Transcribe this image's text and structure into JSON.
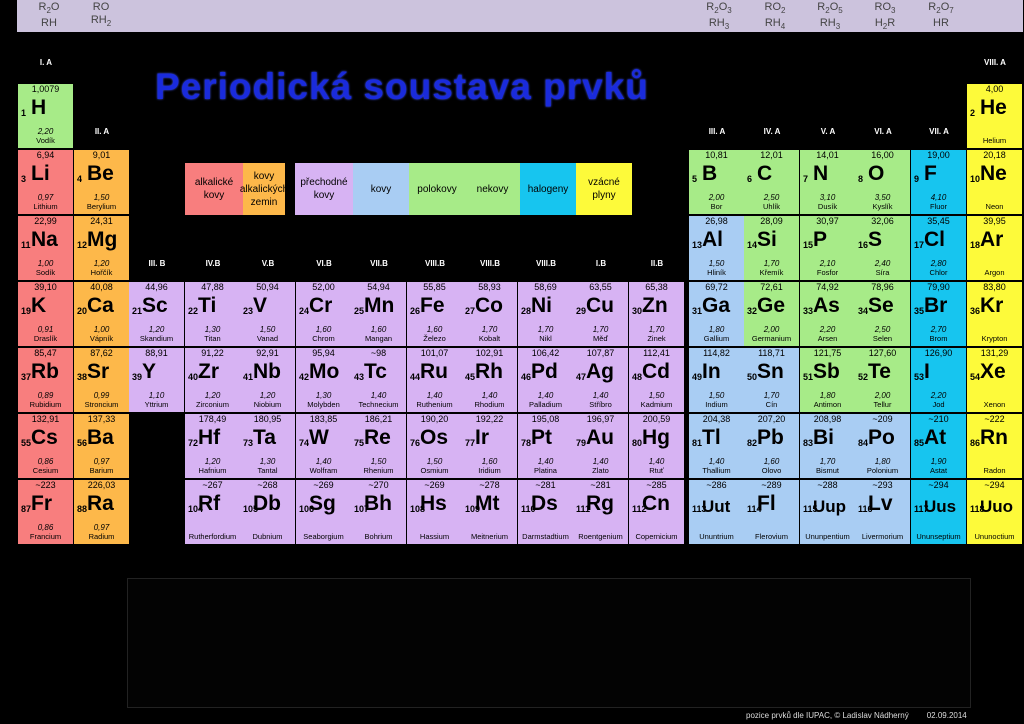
{
  "title": "Periodická soustava prvků",
  "oxides": [
    {
      "l1": "R|2|O",
      "l2": "RH|"
    },
    {
      "l1": "RO|",
      "l2": "RH|2"
    },
    {
      "l1": "R|2|O|3",
      "l2": "RH|3"
    },
    {
      "l1": "RO|2",
      "l2": "RH|4"
    },
    {
      "l1": "R|2|O|5",
      "l2": "RH|3"
    },
    {
      "l1": "RO|3",
      "l2": "H|2|R"
    },
    {
      "l1": "R|2|O|7",
      "l2": "HR|"
    }
  ],
  "groups": [
    "I. A",
    "VIII. A",
    "II. A",
    "III. A",
    "IV. A",
    "V. A",
    "VI. A",
    "VII. A",
    "III. B",
    "IV.B",
    "V.B",
    "VI.B",
    "VII.B",
    "VIII.B",
    "VIII.B",
    "VIII.B",
    "I.B",
    "II.B"
  ],
  "legend": [
    "alkalické kovy",
    "kovy alkalických zemin",
    "přechodné kovy",
    "kovy",
    "polokovy",
    "nekovy",
    "halogeny",
    "vzácné plyny"
  ],
  "colors": {
    "alk": "#f87e7e",
    "zem": "#fdb84a",
    "pre": "#d7b3f3",
    "kov": "#a9cdf3",
    "pol": "#a7eb88",
    "nek": "#a7eb88",
    "hal": "#17c5ef",
    "vzac": "#fdfa3a",
    "title": "#1a2bdc"
  },
  "elements": [
    {
      "m": "1,0079",
      "z": "1",
      "s": "H",
      "e": "2,20",
      "n": "Vodík",
      "c": "nek",
      "col": 1,
      "row": 1
    },
    {
      "m": "4,00",
      "z": "2",
      "s": "He",
      "e": "",
      "n": "Helium",
      "c": "vzac",
      "col": 18,
      "row": 1
    },
    {
      "m": "6,94",
      "z": "3",
      "s": "Li",
      "e": "0,97",
      "n": "Lithium",
      "c": "alk",
      "col": 1,
      "row": 2
    },
    {
      "m": "9,01",
      "z": "4",
      "s": "Be",
      "e": "1,50",
      "n": "Berylium",
      "c": "zem",
      "col": 2,
      "row": 2
    },
    {
      "m": "10,81",
      "z": "5",
      "s": "B",
      "e": "2,00",
      "n": "Bor",
      "c": "pol",
      "col": 13,
      "row": 2
    },
    {
      "m": "12,01",
      "z": "6",
      "s": "C",
      "e": "2,50",
      "n": "Uhlík",
      "c": "nek",
      "col": 14,
      "row": 2
    },
    {
      "m": "14,01",
      "z": "7",
      "s": "N",
      "e": "3,10",
      "n": "Dusík",
      "c": "nek",
      "col": 15,
      "row": 2
    },
    {
      "m": "16,00",
      "z": "8",
      "s": "O",
      "e": "3,50",
      "n": "Kyslík",
      "c": "nek",
      "col": 16,
      "row": 2
    },
    {
      "m": "19,00",
      "z": "9",
      "s": "F",
      "e": "4,10",
      "n": "Fluor",
      "c": "hal",
      "col": 17,
      "row": 2
    },
    {
      "m": "20,18",
      "z": "10",
      "s": "Ne",
      "e": "",
      "n": "Neon",
      "c": "vzac",
      "col": 18,
      "row": 2
    },
    {
      "m": "22,99",
      "z": "11",
      "s": "Na",
      "e": "1,00",
      "n": "Sodík",
      "c": "alk",
      "col": 1,
      "row": 3
    },
    {
      "m": "24,31",
      "z": "12",
      "s": "Mg",
      "e": "1,20",
      "n": "Hořčík",
      "c": "zem",
      "col": 2,
      "row": 3
    },
    {
      "m": "26,98",
      "z": "13",
      "s": "Al",
      "e": "1,50",
      "n": "Hliník",
      "c": "kov",
      "col": 13,
      "row": 3
    },
    {
      "m": "28,09",
      "z": "14",
      "s": "Si",
      "e": "1,70",
      "n": "Křemík",
      "c": "pol",
      "col": 14,
      "row": 3
    },
    {
      "m": "30,97",
      "z": "15",
      "s": "P",
      "e": "2,10",
      "n": "Fosfor",
      "c": "nek",
      "col": 15,
      "row": 3
    },
    {
      "m": "32,06",
      "z": "16",
      "s": "S",
      "e": "2,40",
      "n": "Síra",
      "c": "nek",
      "col": 16,
      "row": 3
    },
    {
      "m": "35,45",
      "z": "17",
      "s": "Cl",
      "e": "2,80",
      "n": "Chlor",
      "c": "hal",
      "col": 17,
      "row": 3
    },
    {
      "m": "39,95",
      "z": "18",
      "s": "Ar",
      "e": "",
      "n": "Argon",
      "c": "vzac",
      "col": 18,
      "row": 3
    },
    {
      "m": "39,10",
      "z": "19",
      "s": "K",
      "e": "0,91",
      "n": "Draslík",
      "c": "alk",
      "col": 1,
      "row": 4
    },
    {
      "m": "40,08",
      "z": "20",
      "s": "Ca",
      "e": "1,00",
      "n": "Vápník",
      "c": "zem",
      "col": 2,
      "row": 4
    },
    {
      "m": "44,96",
      "z": "21",
      "s": "Sc",
      "e": "1,20",
      "n": "Skandium",
      "c": "pre",
      "col": 3,
      "row": 4
    },
    {
      "m": "47,88",
      "z": "22",
      "s": "Ti",
      "e": "1,30",
      "n": "Titan",
      "c": "pre",
      "col": 4,
      "row": 4
    },
    {
      "m": "50,94",
      "z": "23",
      "s": "V",
      "e": "1,50",
      "n": "Vanad",
      "c": "pre",
      "col": 5,
      "row": 4
    },
    {
      "m": "52,00",
      "z": "24",
      "s": "Cr",
      "e": "1,60",
      "n": "Chrom",
      "c": "pre",
      "col": 6,
      "row": 4
    },
    {
      "m": "54,94",
      "z": "25",
      "s": "Mn",
      "e": "1,60",
      "n": "Mangan",
      "c": "pre",
      "col": 7,
      "row": 4
    },
    {
      "m": "55,85",
      "z": "26",
      "s": "Fe",
      "e": "1,60",
      "n": "Železo",
      "c": "pre",
      "col": 8,
      "row": 4
    },
    {
      "m": "58,93",
      "z": "27",
      "s": "Co",
      "e": "1,70",
      "n": "Kobalt",
      "c": "pre",
      "col": 9,
      "row": 4
    },
    {
      "m": "58,69",
      "z": "28",
      "s": "Ni",
      "e": "1,70",
      "n": "Nikl",
      "c": "pre",
      "col": 10,
      "row": 4
    },
    {
      "m": "63,55",
      "z": "29",
      "s": "Cu",
      "e": "1,70",
      "n": "Měď",
      "c": "pre",
      "col": 11,
      "row": 4
    },
    {
      "m": "65,38",
      "z": "30",
      "s": "Zn",
      "e": "1,70",
      "n": "Zinek",
      "c": "pre",
      "col": 12,
      "row": 4
    },
    {
      "m": "69,72",
      "z": "31",
      "s": "Ga",
      "e": "1,80",
      "n": "Gallium",
      "c": "kov",
      "col": 13,
      "row": 4
    },
    {
      "m": "72,61",
      "z": "32",
      "s": "Ge",
      "e": "2,00",
      "n": "Germanium",
      "c": "pol",
      "col": 14,
      "row": 4
    },
    {
      "m": "74,92",
      "z": "33",
      "s": "As",
      "e": "2,20",
      "n": "Arsen",
      "c": "pol",
      "col": 15,
      "row": 4
    },
    {
      "m": "78,96",
      "z": "34",
      "s": "Se",
      "e": "2,50",
      "n": "Selen",
      "c": "nek",
      "col": 16,
      "row": 4
    },
    {
      "m": "79,90",
      "z": "35",
      "s": "Br",
      "e": "2,70",
      "n": "Brom",
      "c": "hal",
      "col": 17,
      "row": 4
    },
    {
      "m": "83,80",
      "z": "36",
      "s": "Kr",
      "e": "",
      "n": "Krypton",
      "c": "vzac",
      "col": 18,
      "row": 4
    },
    {
      "m": "85,47",
      "z": "37",
      "s": "Rb",
      "e": "0,89",
      "n": "Rubidium",
      "c": "alk",
      "col": 1,
      "row": 5
    },
    {
      "m": "87,62",
      "z": "38",
      "s": "Sr",
      "e": "0,99",
      "n": "Stroncium",
      "c": "zem",
      "col": 2,
      "row": 5
    },
    {
      "m": "88,91",
      "z": "39",
      "s": "Y",
      "e": "1,10",
      "n": "Yttrium",
      "c": "pre",
      "col": 3,
      "row": 5
    },
    {
      "m": "91,22",
      "z": "40",
      "s": "Zr",
      "e": "1,20",
      "n": "Zirconium",
      "c": "pre",
      "col": 4,
      "row": 5
    },
    {
      "m": "92,91",
      "z": "41",
      "s": "Nb",
      "e": "1,20",
      "n": "Niobium",
      "c": "pre",
      "col": 5,
      "row": 5
    },
    {
      "m": "95,94",
      "z": "42",
      "s": "Mo",
      "e": "1,30",
      "n": "Molybden",
      "c": "pre",
      "col": 6,
      "row": 5
    },
    {
      "m": "~98",
      "z": "43",
      "s": "Tc",
      "e": "1,40",
      "n": "Technecium",
      "c": "pre",
      "col": 7,
      "row": 5
    },
    {
      "m": "101,07",
      "z": "44",
      "s": "Ru",
      "e": "1,40",
      "n": "Ruthenium",
      "c": "pre",
      "col": 8,
      "row": 5
    },
    {
      "m": "102,91",
      "z": "45",
      "s": "Rh",
      "e": "1,40",
      "n": "Rhodium",
      "c": "pre",
      "col": 9,
      "row": 5
    },
    {
      "m": "106,42",
      "z": "46",
      "s": "Pd",
      "e": "1,40",
      "n": "Palladium",
      "c": "pre",
      "col": 10,
      "row": 5
    },
    {
      "m": "107,87",
      "z": "47",
      "s": "Ag",
      "e": "1,40",
      "n": "Stříbro",
      "c": "pre",
      "col": 11,
      "row": 5
    },
    {
      "m": "112,41",
      "z": "48",
      "s": "Cd",
      "e": "1,50",
      "n": "Kadmium",
      "c": "pre",
      "col": 12,
      "row": 5
    },
    {
      "m": "114,82",
      "z": "49",
      "s": "In",
      "e": "1,50",
      "n": "Indium",
      "c": "kov",
      "col": 13,
      "row": 5
    },
    {
      "m": "118,71",
      "z": "50",
      "s": "Sn",
      "e": "1,70",
      "n": "Cín",
      "c": "kov",
      "col": 14,
      "row": 5
    },
    {
      "m": "121,75",
      "z": "51",
      "s": "Sb",
      "e": "1,80",
      "n": "Antimon",
      "c": "pol",
      "col": 15,
      "row": 5
    },
    {
      "m": "127,60",
      "z": "52",
      "s": "Te",
      "e": "2,00",
      "n": "Tellur",
      "c": "pol",
      "col": 16,
      "row": 5
    },
    {
      "m": "126,90",
      "z": "53",
      "s": "I",
      "e": "2,20",
      "n": "Jod",
      "c": "hal",
      "col": 17,
      "row": 5
    },
    {
      "m": "131,29",
      "z": "54",
      "s": "Xe",
      "e": "",
      "n": "Xenon",
      "c": "vzac",
      "col": 18,
      "row": 5
    },
    {
      "m": "132,91",
      "z": "55",
      "s": "Cs",
      "e": "0,86",
      "n": "Cesium",
      "c": "alk",
      "col": 1,
      "row": 6
    },
    {
      "m": "137,33",
      "z": "56",
      "s": "Ba",
      "e": "0,97",
      "n": "Barium",
      "c": "zem",
      "col": 2,
      "row": 6
    },
    {
      "m": "178,49",
      "z": "72",
      "s": "Hf",
      "e": "1,20",
      "n": "Hafnium",
      "c": "pre",
      "col": 4,
      "row": 6
    },
    {
      "m": "180,95",
      "z": "73",
      "s": "Ta",
      "e": "1,30",
      "n": "Tantal",
      "c": "pre",
      "col": 5,
      "row": 6
    },
    {
      "m": "183,85",
      "z": "74",
      "s": "W",
      "e": "1,40",
      "n": "Wolfram",
      "c": "pre",
      "col": 6,
      "row": 6
    },
    {
      "m": "186,21",
      "z": "75",
      "s": "Re",
      "e": "1,50",
      "n": "Rhenium",
      "c": "pre",
      "col": 7,
      "row": 6
    },
    {
      "m": "190,20",
      "z": "76",
      "s": "Os",
      "e": "1,50",
      "n": "Osmium",
      "c": "pre",
      "col": 8,
      "row": 6
    },
    {
      "m": "192,22",
      "z": "77",
      "s": "Ir",
      "e": "1,60",
      "n": "Iridium",
      "c": "pre",
      "col": 9,
      "row": 6
    },
    {
      "m": "195,08",
      "z": "78",
      "s": "Pt",
      "e": "1,40",
      "n": "Platina",
      "c": "pre",
      "col": 10,
      "row": 6
    },
    {
      "m": "196,97",
      "z": "79",
      "s": "Au",
      "e": "1,40",
      "n": "Zlato",
      "c": "pre",
      "col": 11,
      "row": 6
    },
    {
      "m": "200,59",
      "z": "80",
      "s": "Hg",
      "e": "1,40",
      "n": "Rtuť",
      "c": "pre",
      "col": 12,
      "row": 6
    },
    {
      "m": "204,38",
      "z": "81",
      "s": "Tl",
      "e": "1,40",
      "n": "Thallium",
      "c": "kov",
      "col": 13,
      "row": 6
    },
    {
      "m": "207,20",
      "z": "82",
      "s": "Pb",
      "e": "1,60",
      "n": "Olovo",
      "c": "kov",
      "col": 14,
      "row": 6
    },
    {
      "m": "208,98",
      "z": "83",
      "s": "Bi",
      "e": "1,70",
      "n": "Bismut",
      "c": "kov",
      "col": 15,
      "row": 6
    },
    {
      "m": "~209",
      "z": "84",
      "s": "Po",
      "e": "1,80",
      "n": "Polonium",
      "c": "kov",
      "col": 16,
      "row": 6
    },
    {
      "m": "~210",
      "z": "85",
      "s": "At",
      "e": "1,90",
      "n": "Astat",
      "c": "hal",
      "col": 17,
      "row": 6
    },
    {
      "m": "~222",
      "z": "86",
      "s": "Rn",
      "e": "",
      "n": "Radon",
      "c": "vzac",
      "col": 18,
      "row": 6
    },
    {
      "m": "~223",
      "z": "87",
      "s": "Fr",
      "e": "0,86",
      "n": "Francium",
      "c": "alk",
      "col": 1,
      "row": 7
    },
    {
      "m": "226,03",
      "z": "88",
      "s": "Ra",
      "e": "0,97",
      "n": "Radium",
      "c": "zem",
      "col": 2,
      "row": 7
    },
    {
      "m": "~267",
      "z": "104",
      "s": "Rf",
      "e": "",
      "n": "Rutherfordium",
      "c": "pre",
      "col": 4,
      "row": 7
    },
    {
      "m": "~268",
      "z": "105",
      "s": "Db",
      "e": "",
      "n": "Dubnium",
      "c": "pre",
      "col": 5,
      "row": 7
    },
    {
      "m": "~269",
      "z": "106",
      "s": "Sg",
      "e": "",
      "n": "Seaborgium",
      "c": "pre",
      "col": 6,
      "row": 7
    },
    {
      "m": "~270",
      "z": "107",
      "s": "Bh",
      "e": "",
      "n": "Bohrium",
      "c": "pre",
      "col": 7,
      "row": 7
    },
    {
      "m": "~269",
      "z": "108",
      "s": "Hs",
      "e": "",
      "n": "Hassium",
      "c": "pre",
      "col": 8,
      "row": 7
    },
    {
      "m": "~278",
      "z": "109",
      "s": "Mt",
      "e": "",
      "n": "Meitnerium",
      "c": "pre",
      "col": 9,
      "row": 7
    },
    {
      "m": "~281",
      "z": "110",
      "s": "Ds",
      "e": "",
      "n": "Darmstadtium",
      "c": "pre",
      "col": 10,
      "row": 7
    },
    {
      "m": "~281",
      "z": "111",
      "s": "Rg",
      "e": "",
      "n": "Roentgenium",
      "c": "pre",
      "col": 11,
      "row": 7
    },
    {
      "m": "~285",
      "z": "112",
      "s": "Cn",
      "e": "",
      "n": "Copernicium",
      "c": "pre",
      "col": 12,
      "row": 7
    },
    {
      "m": "~286",
      "z": "113",
      "s": "Uut",
      "e": "",
      "n": "Ununtrium",
      "c": "kov",
      "col": 13,
      "row": 7
    },
    {
      "m": "~289",
      "z": "114",
      "s": "Fl",
      "e": "",
      "n": "Flerovium",
      "c": "kov",
      "col": 14,
      "row": 7
    },
    {
      "m": "~288",
      "z": "115",
      "s": "Uup",
      "e": "",
      "n": "Ununpentium",
      "c": "kov",
      "col": 15,
      "row": 7
    },
    {
      "m": "~293",
      "z": "116",
      "s": "Lv",
      "e": "",
      "n": "Livermorium",
      "c": "kov",
      "col": 16,
      "row": 7
    },
    {
      "m": "~294",
      "z": "117",
      "s": "Uus",
      "e": "",
      "n": "Ununseptium",
      "c": "hal",
      "col": 17,
      "row": 7
    },
    {
      "m": "~294",
      "z": "118",
      "s": "Uuo",
      "e": "",
      "n": "Ununoctium",
      "c": "vzac",
      "col": 18,
      "row": 7
    }
  ],
  "footer": {
    "credit": "pozice prvků dle IUPAC, © Ladislav Nádherný",
    "date": "02.09.2014"
  }
}
